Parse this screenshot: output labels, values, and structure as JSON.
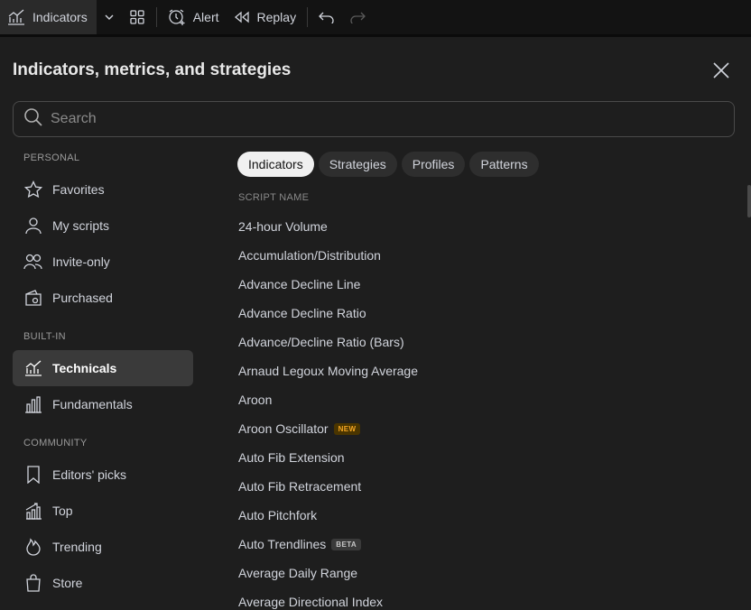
{
  "toolbar": {
    "indicators_label": "Indicators",
    "alert_label": "Alert",
    "replay_label": "Replay"
  },
  "dialog": {
    "title": "Indicators, metrics, and strategies",
    "search_placeholder": "Search"
  },
  "sidebar": {
    "personal_heading": "PERSONAL",
    "personal": [
      {
        "label": "Favorites",
        "icon": "star-icon"
      },
      {
        "label": "My scripts",
        "icon": "user-icon"
      },
      {
        "label": "Invite-only",
        "icon": "users-icon"
      },
      {
        "label": "Purchased",
        "icon": "wallet-icon"
      }
    ],
    "builtin_heading": "BUILT-IN",
    "builtin": [
      {
        "label": "Technicals",
        "icon": "chart-line-icon",
        "active": true
      },
      {
        "label": "Fundamentals",
        "icon": "bar-chart-icon"
      }
    ],
    "community_heading": "COMMUNITY",
    "community": [
      {
        "label": "Editors' picks",
        "icon": "bookmark-icon"
      },
      {
        "label": "Top",
        "icon": "trending-bars-icon"
      },
      {
        "label": "Trending",
        "icon": "flame-icon"
      },
      {
        "label": "Store",
        "icon": "shopping-bag-icon"
      }
    ]
  },
  "tabs": [
    "Indicators",
    "Strategies",
    "Profiles",
    "Patterns"
  ],
  "active_tab": "Indicators",
  "list": {
    "column_header": "SCRIPT NAME",
    "items": [
      {
        "name": "24-hour Volume"
      },
      {
        "name": "Accumulation/Distribution"
      },
      {
        "name": "Advance Decline Line"
      },
      {
        "name": "Advance Decline Ratio"
      },
      {
        "name": "Advance/Decline Ratio (Bars)"
      },
      {
        "name": "Arnaud Legoux Moving Average"
      },
      {
        "name": "Aroon"
      },
      {
        "name": "Aroon Oscillator",
        "badge": "NEW"
      },
      {
        "name": "Auto Fib Extension"
      },
      {
        "name": "Auto Fib Retracement"
      },
      {
        "name": "Auto Pitchfork"
      },
      {
        "name": "Auto Trendlines",
        "badge": "BETA"
      },
      {
        "name": "Average Daily Range"
      },
      {
        "name": "Average Directional Index"
      }
    ]
  },
  "colors": {
    "background": "#1e1e1e",
    "toolbar": "#131313",
    "active_item": "#3a3a3a",
    "active_tab": "#f0f0f0",
    "badge_new": "#f5a623"
  }
}
